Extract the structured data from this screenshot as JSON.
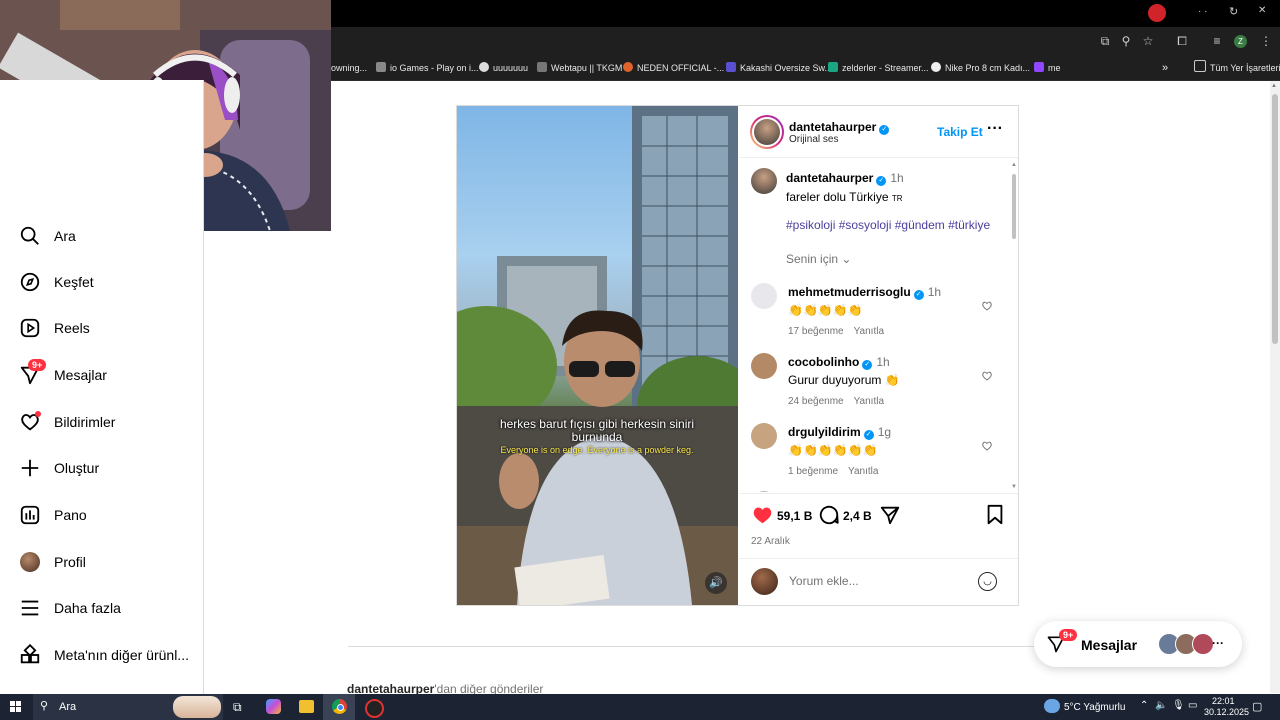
{
  "browser": {
    "bookmarks": [
      "owning...",
      "io Games - Play on i...",
      "uuuuuuu",
      "Webtapu || TKGM",
      "NEDEN OFFICIAL -...",
      "Kakashi Oversize Sw...",
      "zelderler - Streamer...",
      "Nike Pro 8 cm Kadı...",
      "me"
    ],
    "bookmarks_more": "»",
    "all_bookmarks": "Tüm Yer İşaretleri",
    "profile_letter": "Z"
  },
  "sidebar": {
    "items": [
      {
        "label": "Ara",
        "icon": "search-icon"
      },
      {
        "label": "Keşfet",
        "icon": "explore-icon"
      },
      {
        "label": "Reels",
        "icon": "reels-icon"
      },
      {
        "label": "Mesajlar",
        "icon": "messenger-icon",
        "badge": "9+"
      },
      {
        "label": "Bildirimler",
        "icon": "heart-icon",
        "dot": true
      },
      {
        "label": "Oluştur",
        "icon": "plus-icon"
      },
      {
        "label": "Pano",
        "icon": "dashboard-icon"
      },
      {
        "label": "Profil",
        "icon": "avatar"
      },
      {
        "label": "Daha fazla",
        "icon": "menu-icon"
      },
      {
        "label": "Meta'nın diğer ürünl...",
        "icon": "apps-icon"
      }
    ]
  },
  "post": {
    "author": "dantetahaurper",
    "audio": "Orijinal ses",
    "follow_label": "Takip Et",
    "caption_time": "1h",
    "caption": "fareler dolu Türkiye 🇹🇷",
    "caption_flag_text": "TR",
    "caption_text": "fareler dolu Türkiye",
    "hashtags": "#psikoloji #sosyoloji #gündem #türkiye",
    "sort_label": "Senin için",
    "subtitle_tr": "herkes barut fıçısı gibi herkesin siniri burnunda",
    "subtitle_en": "Everyone is on edge. Everyone is a powder keg.",
    "likes": "59,1 B",
    "comments_count": "2,4 B",
    "date": "22 Aralık",
    "comment_placeholder": "Yorum ekle...",
    "comments": [
      {
        "user": "mehmetmuderrisoglu",
        "time": "1h",
        "text": "👏👏👏👏👏",
        "likes": "17 beğenme",
        "reply": "Yanıtla",
        "avatar_color": "#e8e8ec"
      },
      {
        "user": "cocobolinho",
        "time": "1h",
        "text": "Gurur duyuyorum 👏",
        "likes": "24 beğenme",
        "reply": "Yanıtla",
        "avatar_color": "#b48a66"
      },
      {
        "user": "drgulyildirim",
        "time": "1g",
        "text": "👏👏👏👏👏👏",
        "likes": "1 beğenme",
        "reply": "Yanıtla",
        "avatar_color": "#c7a37f"
      }
    ]
  },
  "more_posts": {
    "user": "dantetahaurper",
    "suffix": "'dan diğer gönderiler"
  },
  "messages_pill": {
    "label": "Mesajlar",
    "badge": "9+"
  },
  "taskbar": {
    "search_label": "Ara",
    "weather": "5°C Yağmurlu",
    "time": "22:01",
    "date": "30.12.2025"
  },
  "colors": {
    "accent": "#0095f6",
    "like": "#ff3040",
    "hashtag": "#4a3f9f"
  }
}
